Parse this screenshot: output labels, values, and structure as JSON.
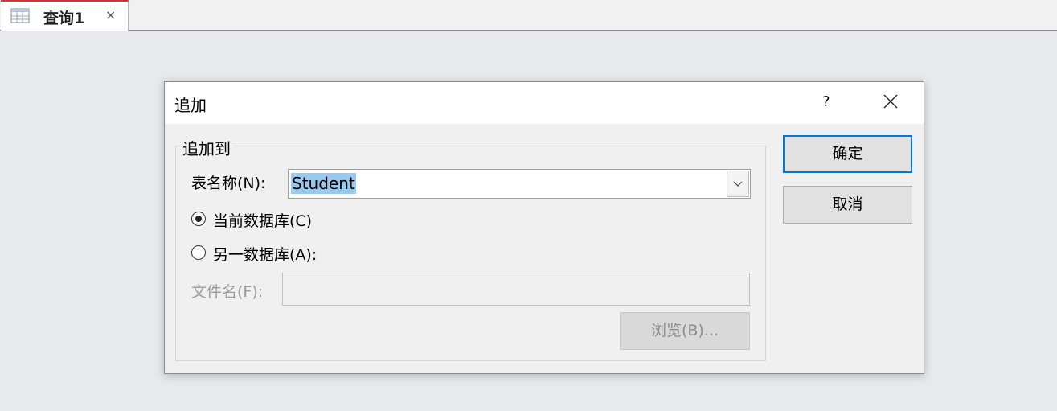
{
  "tab": {
    "title": "查询1",
    "close_glyph": "×",
    "icon": "query-icon"
  },
  "dialog": {
    "title": "追加",
    "help_glyph": "?",
    "group_label": "追加到",
    "table_name_label": "表名称(N):",
    "table_name_value": "Student",
    "radio_current": {
      "label": "当前数据库(C)",
      "checked": true
    },
    "radio_other": {
      "label": "另一数据库(A):",
      "checked": false
    },
    "file_name_label": "文件名(F):",
    "file_name_value": "",
    "browse_label": "浏览(B)...",
    "ok_label": "确定",
    "cancel_label": "取消"
  },
  "colors": {
    "accent": "#0078d7",
    "tab_accent": "#d13438",
    "selection": "#99c9ef"
  }
}
